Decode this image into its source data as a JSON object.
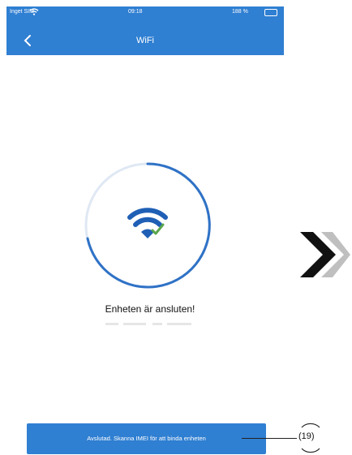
{
  "status_bar": {
    "carrier": "Inget SIM",
    "time": "09:18",
    "battery": "188 %"
  },
  "nav": {
    "title": "WiFi",
    "back_icon": "chevron-left-icon"
  },
  "connection": {
    "icon": "wifi-check-icon",
    "message": "Enheten är ansluten!"
  },
  "action_bar": {
    "label": "Avslutad. Skanna IMEI för att binda enheten"
  },
  "callout": {
    "label": "(19)"
  },
  "decor": {
    "arrows_icon": "double-chevron-right-icon"
  },
  "colors": {
    "accent": "#2f7fd2",
    "check": "#5aa64b"
  }
}
